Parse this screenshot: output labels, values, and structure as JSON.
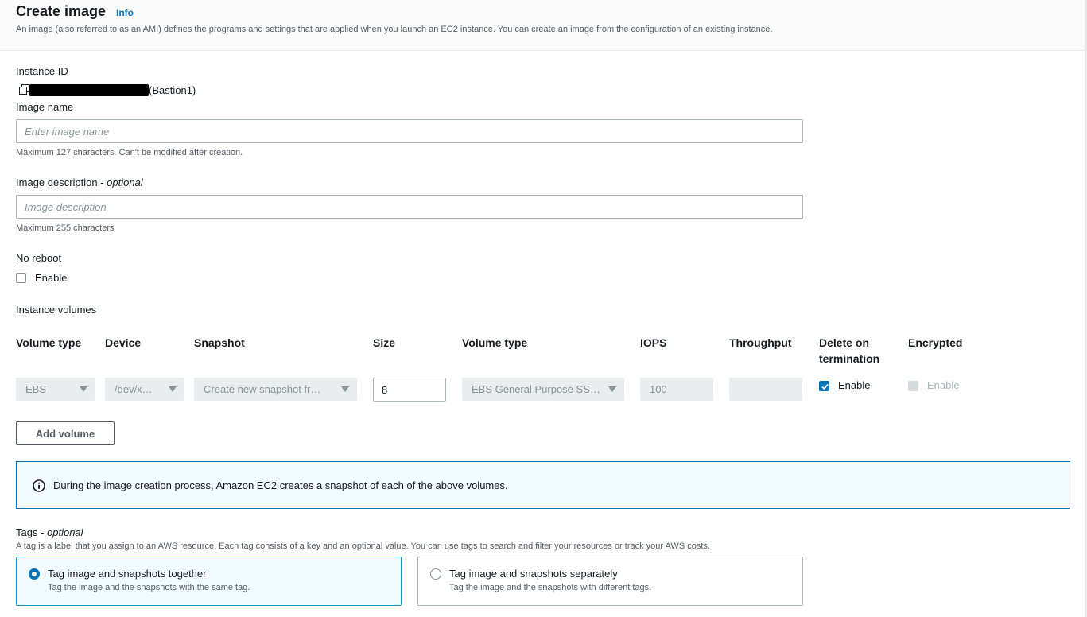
{
  "header": {
    "title": "Create image",
    "info": "Info",
    "description": "An image (also referred to as an AMI) defines the programs and settings that are applied when you launch an EC2 instance. You can create an image from the configuration of an existing instance."
  },
  "instance": {
    "label": "Instance ID",
    "value_suffix": "(Bastion1)"
  },
  "image_name": {
    "label": "Image name",
    "placeholder": "Enter image name",
    "hint": "Maximum 127 characters. Can't be modified after creation."
  },
  "image_description": {
    "label": "Image description - ",
    "optional": "optional",
    "placeholder": "Image description",
    "hint": "Maximum 255 characters"
  },
  "no_reboot": {
    "label": "No reboot",
    "checkbox_label": "Enable"
  },
  "volumes": {
    "label": "Instance volumes",
    "columns": {
      "volume_type": "Volume type",
      "device": "Device",
      "snapshot": "Snapshot",
      "size": "Size",
      "volume_type2": "Volume type",
      "iops": "IOPS",
      "throughput": "Throughput",
      "delete_line1": "Delete on",
      "delete_line2": "termination",
      "encrypted": "Encrypted"
    },
    "row": {
      "volume_type": "EBS",
      "device": "/dev/x…",
      "snapshot": "Create new snapshot fr…",
      "size": "8",
      "ebs_type": "EBS General Purpose SS…",
      "iops": "100",
      "throughput": "",
      "delete_label": "Enable",
      "encrypted_label": "Enable"
    },
    "add_button": "Add volume"
  },
  "alert": {
    "text": "During the image creation process, Amazon EC2 creates a snapshot of each of the above volumes."
  },
  "tags": {
    "label": "Tags - ",
    "optional": "optional",
    "description": "A tag is a label that you assign to an AWS resource. Each tag consists of a key and an optional value. You can use tags to search and filter your resources or track your AWS costs.",
    "options": [
      {
        "title": "Tag image and snapshots together",
        "desc": "Tag the image and the snapshots with the same tag."
      },
      {
        "title": "Tag image and snapshots separately",
        "desc": "Tag the image and the snapshots with different tags."
      }
    ]
  },
  "colors": {
    "accent": "#0073bb",
    "selected_bg": "#f1faff",
    "disabled_bg": "#eaeded"
  }
}
